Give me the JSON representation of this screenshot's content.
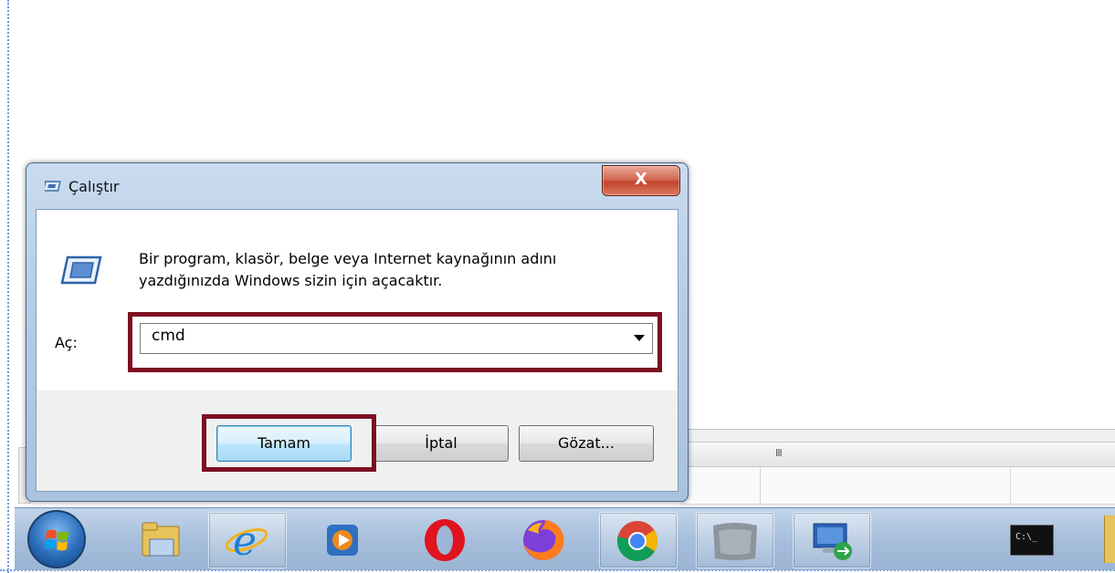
{
  "dialog": {
    "title": "Çalıştır",
    "close_label": "X",
    "description": "Bir program, klasör, belge veya Internet kaynağının adını yazdığınızda Windows sizin için açacaktır.",
    "open_label": "Aç:",
    "input_value": "cmd",
    "ok_label": "Tamam",
    "cancel_label": "İptal",
    "browse_label": "Gözat..."
  },
  "background_window": {
    "scroll_grip": "III"
  },
  "taskbar": {
    "items": [
      {
        "name": "start-button"
      },
      {
        "name": "file-explorer"
      },
      {
        "name": "internet-explorer"
      },
      {
        "name": "media-player"
      },
      {
        "name": "opera"
      },
      {
        "name": "firefox"
      },
      {
        "name": "chrome"
      },
      {
        "name": "blurred-app"
      },
      {
        "name": "remote-desktop"
      },
      {
        "name": "command-prompt",
        "label": "C:\\_"
      }
    ]
  },
  "colors": {
    "highlight_box": "#7b1020",
    "taskbar": "#a7bfdc",
    "dialog_frame": "#b7cde6"
  }
}
